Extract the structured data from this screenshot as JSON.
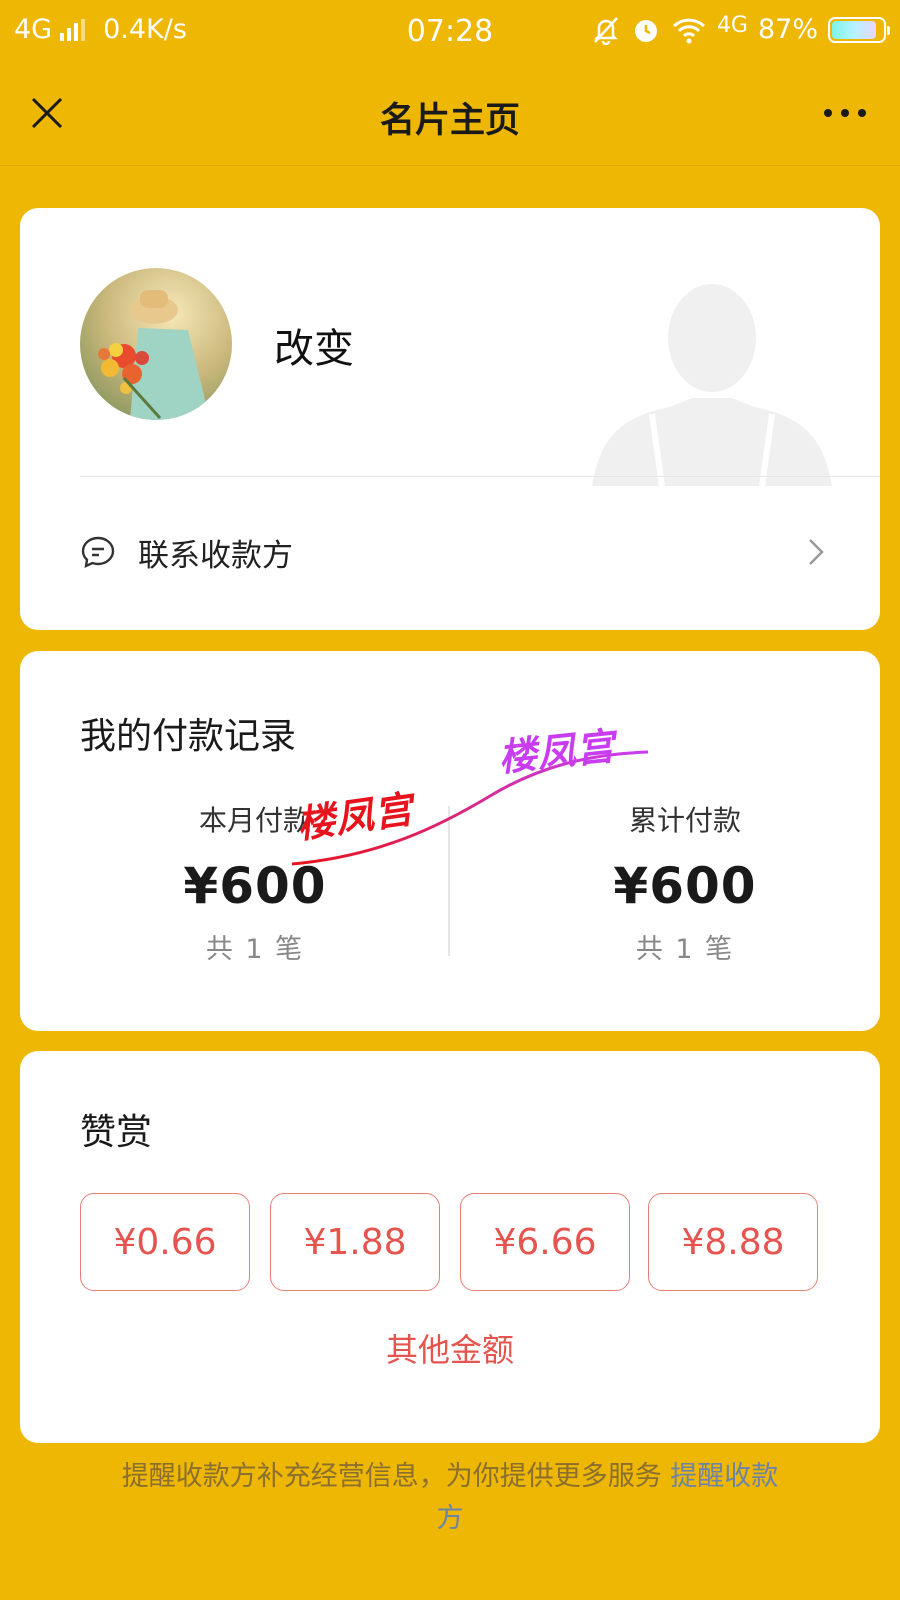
{
  "status_bar": {
    "network": "4G",
    "speed": "0.4K/s",
    "time": "07:28",
    "network_right": "4G",
    "battery": "87%",
    "battery_level": 0.87
  },
  "nav": {
    "title": "名片主页"
  },
  "profile": {
    "name": "改变",
    "contact_label": "联系收款方"
  },
  "records": {
    "title": "我的付款记录",
    "month_label": "本月付款",
    "month_amount": "¥600",
    "month_count": "共 1 笔",
    "total_label": "累计付款",
    "total_amount": "¥600",
    "total_count": "共 1 笔",
    "watermark_1": "楼凤宫",
    "watermark_2": "楼凤宫"
  },
  "tip": {
    "title": "赞赏",
    "amounts": [
      "¥0.66",
      "¥1.88",
      "¥6.66",
      "¥8.88"
    ],
    "other_label": "其他金额"
  },
  "footer": {
    "text": "提醒收款方补充经营信息，为你提供更多服务 ",
    "link": "提醒收款方"
  },
  "colors": {
    "background": "#EEB704",
    "accent_red": "#E5544E",
    "link_blue": "#6E84A3"
  }
}
